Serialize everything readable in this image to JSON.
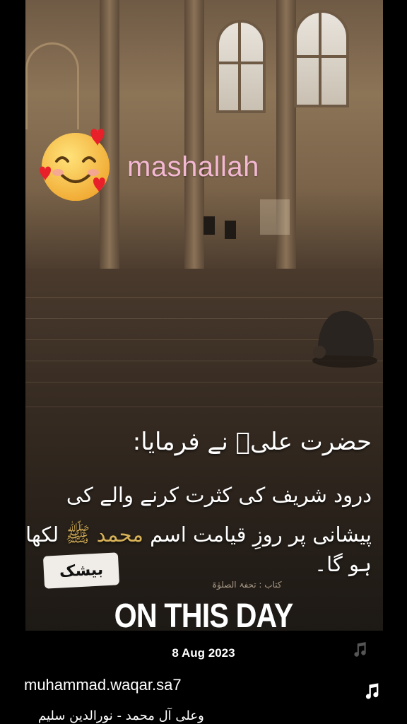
{
  "overlay": {
    "sticker_text": "mashallah"
  },
  "quote": {
    "line1": "حضرت علیؑ نے فرمایا:",
    "line2": "درود شریف کی کثرت کرنے والے کی",
    "line3_part1": "پیشانی پر روزِ قیامت اسم ",
    "line3_highlight": "محمد ﷺ",
    "line3_part2": " لکھا ہو گا۔",
    "reference": "کتاب : تحفۃ الصلوٰۃ",
    "stamp": "بیشک"
  },
  "memory": {
    "title": "ON THIS DAY",
    "date": "8 Aug 2023"
  },
  "post": {
    "username": "muhammad.waqar.sa7",
    "audio": "وعلی آل محمد - نورالدین سلیم"
  },
  "colors": {
    "sticker_pink": "#f3b8d2",
    "highlight_gold": "#d8b258",
    "background": "#000000"
  }
}
